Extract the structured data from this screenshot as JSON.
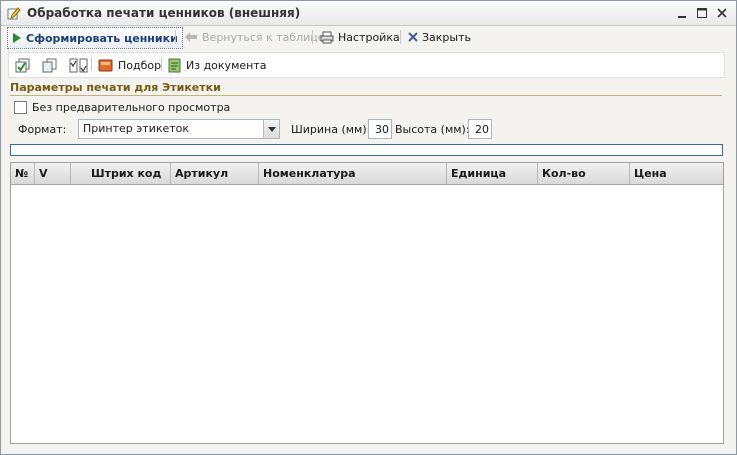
{
  "window": {
    "title": "Обработка печати ценников (внешняя)",
    "controls": [
      "minimize",
      "maximize",
      "close"
    ]
  },
  "toolbar": {
    "generate_label": "Сформировать ценники",
    "back_label": "Вернуться к таблице",
    "settings_label": "Настройка",
    "close_label": "Закрыть"
  },
  "subtoolbar": {
    "select_label": "Подбор",
    "from_document_label": "Из документа",
    "icons": [
      "check-all-icon",
      "copy-icon",
      "checkbox-toggle-icon",
      "book-icon",
      "document-icon"
    ]
  },
  "params": {
    "section_title": "Параметры печати для Этикетки",
    "no_preview_label": "Без предварительного просмотра",
    "no_preview_checked": false,
    "format_label": "Формат:",
    "format_value": "Принтер этикеток",
    "width_label": "Ширина (мм):",
    "width_value": "30",
    "height_label": "Высота (мм):",
    "height_value": "20"
  },
  "progress": {
    "value": 0
  },
  "table": {
    "columns": [
      "№",
      "V",
      "Штрих код",
      "Артикул",
      "Номенклатура",
      "Единица",
      "Кол-во",
      "Цена"
    ],
    "rows": []
  }
}
